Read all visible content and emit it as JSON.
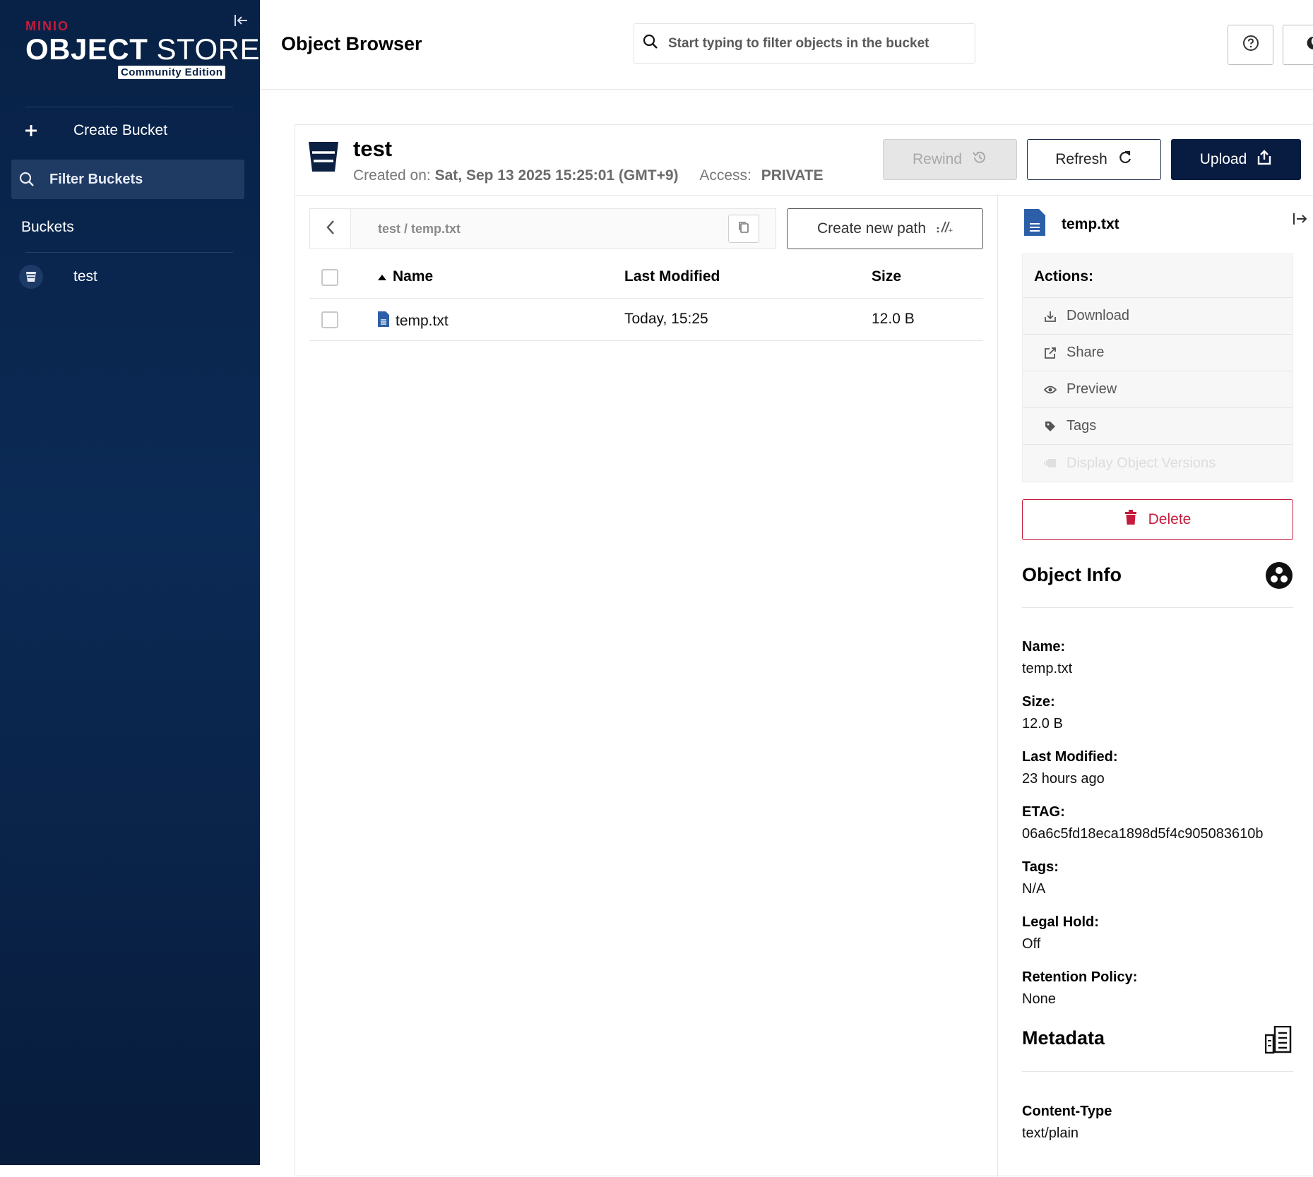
{
  "sidebar": {
    "logo_minio": "MINIO",
    "logo_object": "OBJECT",
    "logo_store": " STORE",
    "logo_badge": "Community Edition",
    "create_bucket": "Create Bucket",
    "filter_buckets": "Filter Buckets",
    "buckets_title": "Buckets",
    "buckets": [
      {
        "name": "test"
      }
    ]
  },
  "header": {
    "title": "Object Browser",
    "search_placeholder": "Start typing to filter objects in the bucket"
  },
  "bucket": {
    "name": "test",
    "created_label": "Created on:",
    "created_value": "Sat, Sep 13 2025 15:25:01 (GMT+9)",
    "access_label": "Access:",
    "access_value": "PRIVATE",
    "rewind": "Rewind",
    "refresh": "Refresh",
    "upload": "Upload"
  },
  "breadcrumb": {
    "path": "test  /  temp.txt"
  },
  "create_new_path": "Create new path",
  "table": {
    "columns": {
      "name": "Name",
      "last_modified": "Last Modified",
      "size": "Size"
    },
    "rows": [
      {
        "name": "temp.txt",
        "last_modified": "Today, 15:25",
        "size": "12.0 B"
      }
    ]
  },
  "details": {
    "file_name": "temp.txt",
    "actions_title": "Actions:",
    "actions": [
      "Download",
      "Share",
      "Preview",
      "Tags",
      "Display Object Versions"
    ],
    "delete": "Delete",
    "object_info_title": "Object Info",
    "info": [
      {
        "label": "Name:",
        "value": "temp.txt"
      },
      {
        "label": "Size:",
        "value": "12.0 B"
      },
      {
        "label": "Last Modified:",
        "value": "23 hours ago"
      },
      {
        "label": "ETAG:",
        "value": "06a6c5fd18eca1898d5f4c905083610b"
      },
      {
        "label": "Tags:",
        "value": "N/A"
      },
      {
        "label": "Legal Hold:",
        "value": "Off"
      },
      {
        "label": "Retention Policy:",
        "value": "None"
      }
    ],
    "metadata_title": "Metadata",
    "metadata": [
      {
        "label": "Content-Type",
        "value": "text/plain"
      }
    ]
  },
  "colors": {
    "sidebar_bg": "#0b2a55",
    "brand_red": "#c51b3c",
    "primary": "#081c42",
    "delete": "#c51b3c"
  }
}
